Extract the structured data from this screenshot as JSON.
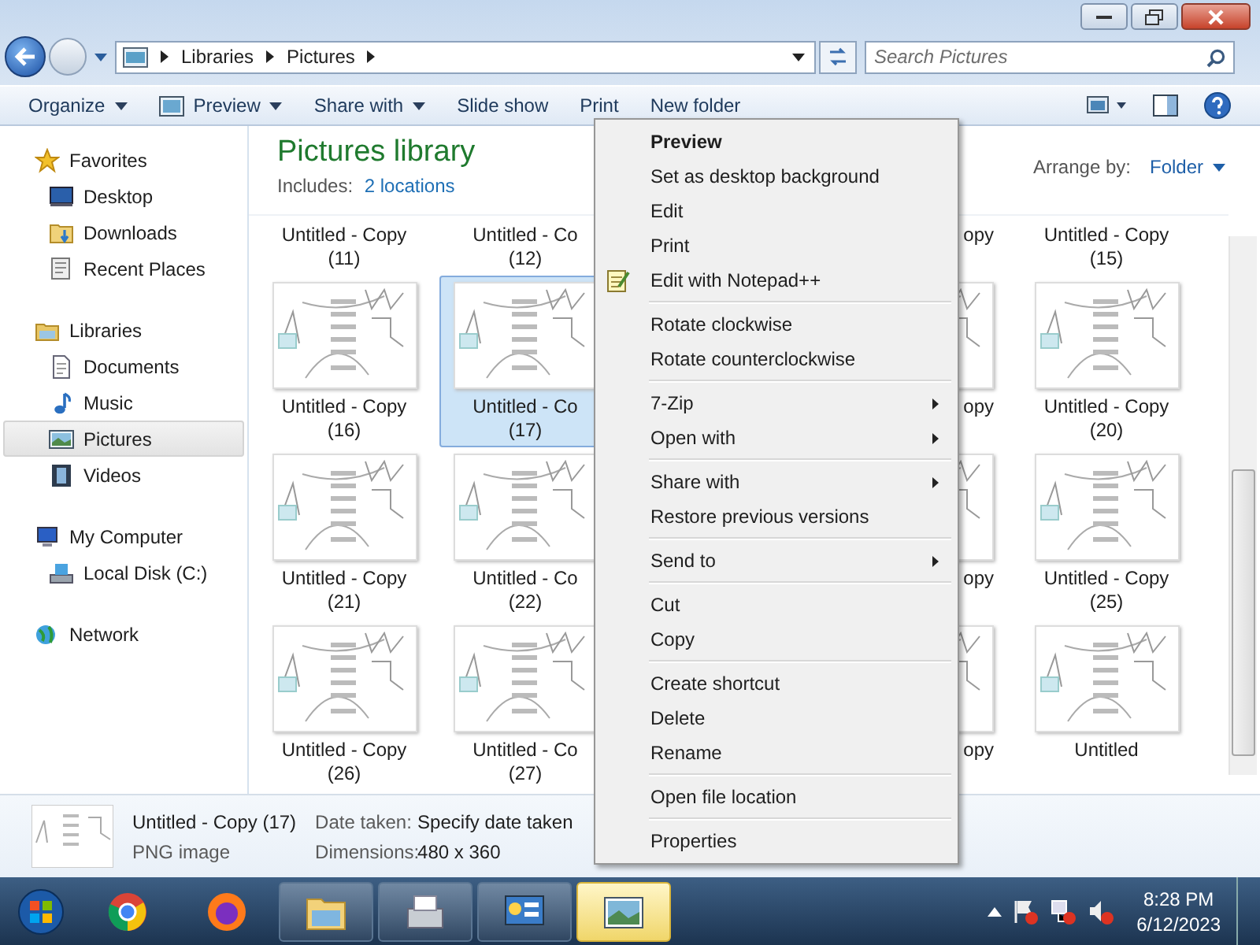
{
  "address": {
    "breadcrumbs": [
      "Libraries",
      "Pictures"
    ]
  },
  "search": {
    "placeholder": "Search Pictures"
  },
  "toolbar": {
    "buttons": [
      {
        "label": "Organize",
        "dropdown": true,
        "kind": "text"
      },
      {
        "label": "Preview",
        "dropdown": true,
        "kind": "icon"
      },
      {
        "label": "Share with",
        "dropdown": true,
        "kind": "text"
      },
      {
        "label": "Slide show",
        "dropdown": false,
        "kind": "text"
      },
      {
        "label": "Print",
        "dropdown": false,
        "kind": "text"
      },
      {
        "label": "New folder",
        "dropdown": false,
        "kind": "text"
      }
    ]
  },
  "sidebar": {
    "groups": [
      {
        "label": "Favorites",
        "selected": false,
        "children": [
          {
            "label": "Desktop",
            "selected": false
          },
          {
            "label": "Downloads",
            "selected": false
          },
          {
            "label": "Recent Places",
            "selected": false
          }
        ]
      },
      {
        "label": "Libraries",
        "selected": false,
        "children": [
          {
            "label": "Documents",
            "selected": false
          },
          {
            "label": "Music",
            "selected": false
          },
          {
            "label": "Pictures",
            "selected": true
          },
          {
            "label": "Videos",
            "selected": false
          }
        ]
      },
      {
        "label": "My Computer",
        "selected": false,
        "children": [
          {
            "label": "Local Disk (C:)",
            "selected": false
          }
        ]
      },
      {
        "label": "Network",
        "selected": false
      }
    ]
  },
  "header": {
    "title": "Pictures library",
    "includes_label": "Includes:",
    "includes_link": "2 locations",
    "arrange_label": "Arrange by:",
    "arrange_value": "Folder"
  },
  "grid": {
    "rows": [
      [
        {
          "name": "Untitled - Copy",
          "number": "(11)",
          "selected": false
        },
        {
          "name": "Untitled - Co",
          "number": "(12)",
          "selected": false
        },
        {
          "name": "opy",
          "selected": false
        },
        {
          "name": "Untitled - Copy",
          "number": "(15)",
          "selected": false
        }
      ],
      [
        {
          "name": "Untitled - Copy",
          "number": "(16)",
          "selected": false
        },
        {
          "name": "Untitled - Co",
          "number": "(17)",
          "selected": true
        },
        {
          "name": "opy",
          "selected": false
        },
        {
          "name": "Untitled - Copy",
          "number": "(20)",
          "selected": false
        }
      ],
      [
        {
          "name": "Untitled - Copy",
          "number": "(21)",
          "selected": false
        },
        {
          "name": "Untitled - Co",
          "number": "(22)",
          "selected": false
        },
        {
          "name": "opy",
          "selected": false
        },
        {
          "name": "Untitled - Copy",
          "number": "(25)",
          "selected": false
        }
      ],
      [
        {
          "name": "Untitled - Copy",
          "number": "(26)",
          "selected": false
        },
        {
          "name": "Untitled - Co",
          "number": "(27)",
          "selected": false
        },
        {
          "name": "opy",
          "selected": false
        },
        {
          "name": "Untitled",
          "selected": false
        }
      ]
    ]
  },
  "details": {
    "name": "Untitled - Copy (17)",
    "type": "PNG image",
    "fields": [
      {
        "label": "Date taken:",
        "value": "Specify date taken"
      },
      {
        "label": "Dimensions:",
        "value": "480 x 360"
      }
    ]
  },
  "context_menu": {
    "groups": [
      [
        {
          "label": "Preview",
          "default": true,
          "submenu": false,
          "kind": "text"
        },
        {
          "label": "Set as desktop background",
          "default": false,
          "submenu": false,
          "kind": "text"
        },
        {
          "label": "Edit",
          "default": false,
          "submenu": false,
          "kind": "text"
        },
        {
          "label": "Print",
          "default": false,
          "submenu": false,
          "kind": "text"
        },
        {
          "label": "Edit with Notepad++",
          "default": false,
          "submenu": false,
          "kind": "icon"
        }
      ],
      [
        {
          "label": "Rotate clockwise",
          "default": false,
          "submenu": false,
          "kind": "text"
        },
        {
          "label": "Rotate counterclockwise",
          "default": false,
          "submenu": false,
          "kind": "text"
        }
      ],
      [
        {
          "label": "7-Zip",
          "default": false,
          "submenu": true,
          "kind": "text"
        },
        {
          "label": "Open with",
          "default": false,
          "submenu": true,
          "kind": "text"
        }
      ],
      [
        {
          "label": "Share with",
          "default": false,
          "submenu": true,
          "kind": "text"
        },
        {
          "label": "Restore previous versions",
          "default": false,
          "submenu": false,
          "kind": "text"
        }
      ],
      [
        {
          "label": "Send to",
          "default": false,
          "submenu": true,
          "kind": "text"
        }
      ],
      [
        {
          "label": "Cut",
          "default": false,
          "submenu": false,
          "kind": "text"
        },
        {
          "label": "Copy",
          "default": false,
          "submenu": false,
          "kind": "text"
        }
      ],
      [
        {
          "label": "Create shortcut",
          "default": false,
          "submenu": false,
          "kind": "text"
        },
        {
          "label": "Delete",
          "default": false,
          "submenu": false,
          "kind": "text"
        },
        {
          "label": "Rename",
          "default": false,
          "submenu": false,
          "kind": "text"
        }
      ],
      [
        {
          "label": "Open file location",
          "default": false,
          "submenu": false,
          "kind": "text"
        }
      ],
      [
        {
          "label": "Properties",
          "default": false,
          "submenu": false,
          "kind": "text"
        }
      ]
    ]
  },
  "taskbar": {
    "buttons": [
      {
        "selected": false
      },
      {
        "selected": false
      },
      {
        "selected": false
      },
      {
        "selected": false
      },
      {
        "selected": false
      },
      {
        "selected": true
      }
    ],
    "clock": {
      "time": "8:28 PM",
      "date": "6/12/2023"
    }
  }
}
